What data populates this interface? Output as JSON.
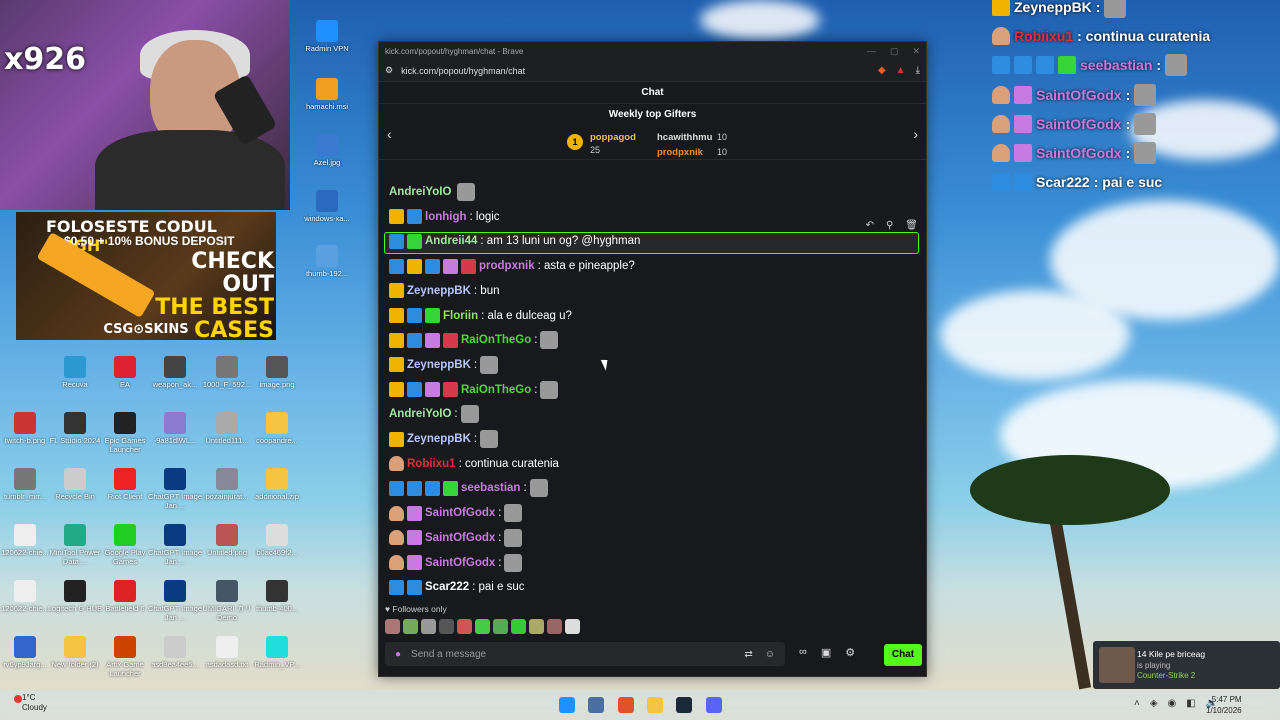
{
  "webcam": {
    "overlay_text": "x926"
  },
  "ad": {
    "line1_prefix": "FOLOSESTE CODUL ",
    "line1_code": "\"HIGH\"",
    "line2": "$0.50 + 10% BONUS DEPOSIT",
    "line3a": "CHECK OUT",
    "line3b": "THE BEST",
    "line3c": "CASES",
    "brand": "CSG⊙SKINS"
  },
  "desktop_icons": [
    {
      "label": "Radmin VPN"
    },
    {
      "label": "hamachi.msi"
    },
    {
      "label": "Azel.jpg"
    },
    {
      "label": "windows-xa..."
    },
    {
      "label": "thumb-192..."
    },
    {
      "label": "Recuva"
    },
    {
      "label": "EA"
    },
    {
      "label": "weapon_ak..."
    },
    {
      "label": "1000_F_592..."
    },
    {
      "label": "image.png"
    },
    {
      "label": "twitch-b.png"
    },
    {
      "label": "FL Studio 2024"
    },
    {
      "label": "Epic Games Launcher"
    },
    {
      "label": "-9a81dlWL..."
    },
    {
      "label": "Untitled111..."
    },
    {
      "label": "coopandre..."
    },
    {
      "label": "tumblr_mrr..."
    },
    {
      "label": "Recycle Bin"
    },
    {
      "label": "Riot Client"
    },
    {
      "label": "ChatGPT Image Jan ..."
    },
    {
      "label": "pozainjurat..."
    },
    {
      "label": "additional.zip"
    },
    {
      "label": "120622-chie..."
    },
    {
      "label": "MiniTool Power Data ..."
    },
    {
      "label": "Google Play Games"
    },
    {
      "label": "ChatGPT Image Jan ..."
    },
    {
      "label": "Untitled.png"
    },
    {
      "label": "b0ac469f2..."
    },
    {
      "label": "120622-chie..."
    },
    {
      "label": "Logitech G HUB"
    },
    {
      "label": "Battlefield 6"
    },
    {
      "label": "ChatGPT Image Jan ..."
    },
    {
      "label": "UMIGARI カリ Demo"
    },
    {
      "label": "thumb-400..."
    },
    {
      "label": "rv6yp9Jarg..."
    },
    {
      "label": "New folder (2)"
    },
    {
      "label": "Artix Game Launcher"
    },
    {
      "label": "asd8ea4ee5..."
    },
    {
      "label": "asdadasd.txt"
    },
    {
      "label": "Radmin_VP..."
    }
  ],
  "browser": {
    "title": "kick.com/popout/hyghman/chat - Brave",
    "url": "kick.com/popout/hyghman/chat",
    "controls": [
      "—",
      "▢",
      "✕"
    ]
  },
  "chat": {
    "header": "Chat",
    "gifters": {
      "title": "Weekly top Gifters",
      "first": {
        "rank": "1",
        "name": "poppagod",
        "count": "25"
      },
      "second": {
        "name": "hcawithhmu",
        "count": "10"
      },
      "third": {
        "name": "prodpxnik",
        "count": "10"
      }
    },
    "messages": [
      {
        "user": "AndreiYoIO",
        "text": "",
        "color": "#9fe6a0"
      },
      {
        "user": "lonhigh",
        "text": ": logic",
        "color": "#c77ae0"
      },
      {
        "user": "Andreii44",
        "text": ": am 13 luni un og? @hyghman",
        "color": "#9fe6a0"
      },
      {
        "user": "prodpxnik",
        "text": ": asta e pineapple?",
        "color": "#c77ae0"
      },
      {
        "user": "ZeyneppBK",
        "text": ": bun",
        "color": "#b6c6ff"
      },
      {
        "user": "Floriin",
        "text": ": ala e dulceag u?",
        "color": "#8fe26a"
      },
      {
        "user": "RaiOnTheGo",
        "text": ":",
        "color": "#4fd63a"
      },
      {
        "user": "ZeyneppBK",
        "text": ":",
        "color": "#b6c6ff"
      },
      {
        "user": "RaiOnTheGo",
        "text": ":",
        "color": "#4fd63a"
      },
      {
        "user": "AndreiYoIO",
        "text": ":",
        "color": "#9fe6a0"
      },
      {
        "user": "ZeyneppBK",
        "text": ":",
        "color": "#b6c6ff"
      },
      {
        "user": "Robiixu1",
        "text": ": continua curatenia",
        "color": "#e0303a"
      },
      {
        "user": "seebastian",
        "text": ":",
        "color": "#c77ae0"
      },
      {
        "user": "SaintOfGodx",
        "text": ":",
        "color": "#c77ae0"
      },
      {
        "user": "SaintOfGodx",
        "text": ":",
        "color": "#c77ae0"
      },
      {
        "user": "SaintOfGodx",
        "text": ":",
        "color": "#c77ae0"
      },
      {
        "user": "Scar222",
        "text": ": pai e suc",
        "color": "#ffffff"
      }
    ],
    "followers_only": "Followers only",
    "input_placeholder": "Send a message",
    "send_label": "Chat"
  },
  "overlay_chat": [
    {
      "user": "ZeyneppBK",
      "text": ":",
      "color": "#ffffff"
    },
    {
      "user": "Robiixu1",
      "text": ": continua curatenia",
      "color": "#e0303a"
    },
    {
      "user": "seebastian",
      "text": ":",
      "color": "#c77ae0"
    },
    {
      "user": "SaintOfGodx",
      "text": ":",
      "color": "#c77ae0"
    },
    {
      "user": "SaintOfGodx",
      "text": ":",
      "color": "#c77ae0"
    },
    {
      "user": "SaintOfGodx",
      "text": ":",
      "color": "#c77ae0"
    },
    {
      "user": "Scar222",
      "text": ": pai e suc",
      "color": "#ffffff"
    }
  ],
  "notification": {
    "title": "14 Kile pe briceag",
    "status": "is playing",
    "game": "Counter-Strike 2"
  },
  "taskbar": {
    "weather_temp": "1°C",
    "weather_desc": "Cloudy",
    "time": "5:47 PM",
    "date": "1/10/2026"
  },
  "colors": {
    "kick_green": "#53fc18",
    "crown": "#f0b400"
  }
}
